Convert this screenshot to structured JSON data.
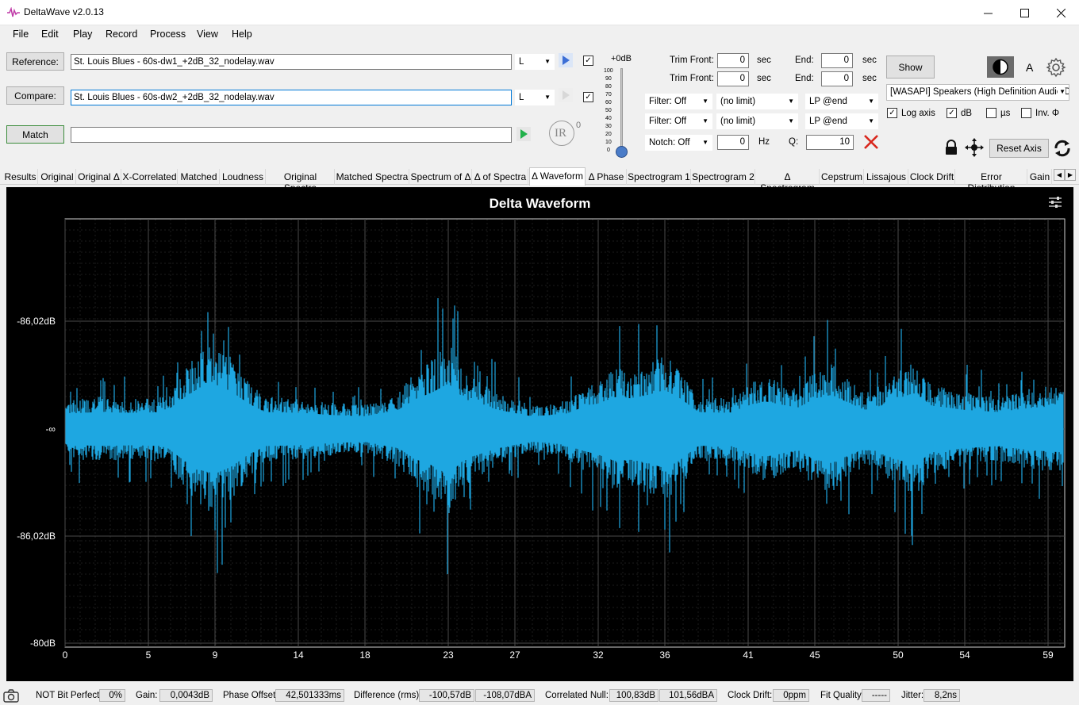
{
  "window": {
    "title": "DeltaWave v2.0.13"
  },
  "menu": [
    "File",
    "Edit",
    "Play",
    "Record",
    "Process",
    "View",
    "Help"
  ],
  "files": {
    "reference_label": "Reference:",
    "reference_file": "St. Louis Blues - 60s-dw1_+2dB_32_nodelay.wav",
    "reference_channel": "L",
    "compare_label": "Compare:",
    "compare_file": "St. Louis Blues - 60s-dw2_+2dB_32_nodelay.wav",
    "compare_channel": "L",
    "match_label": "Match",
    "ir_label": "IR",
    "ir_exponent": "0"
  },
  "volume": {
    "top_label": "+0dB",
    "scale": [
      "100",
      "90",
      "80",
      "70",
      "60",
      "50",
      "40",
      "30",
      "20",
      "10",
      "0"
    ]
  },
  "trim": {
    "front_label": "Trim Front:",
    "front1": "0",
    "front2": "0",
    "unit": "sec",
    "end_label": "End:",
    "end1": "0",
    "end2": "0"
  },
  "filters": {
    "filter1": "Filter: Off",
    "limit1": "(no limit)",
    "lp1": "LP @end",
    "filter2": "Filter: Off",
    "limit2": "(no limit)",
    "lp2": "LP @end",
    "notch": "Notch: Off",
    "notch_value": "0",
    "hz_label": "Hz",
    "q_label": "Q:",
    "q_value": "10"
  },
  "output": {
    "show_label": "Show",
    "device": "[WASAPI] Speakers (High Definition Audio D",
    "theme_letter": "A"
  },
  "options": {
    "log_axis": "Log axis",
    "db": "dB",
    "us": "µs",
    "inv": "Inv. Φ",
    "reset_axis": "Reset Axis"
  },
  "tabs": [
    "Results",
    "Original",
    "Original Δ",
    "X-Correlated",
    "Matched",
    "Loudness",
    "Original Spectra",
    "Matched Spectra",
    "Spectrum of Δ",
    "Δ of Spectra",
    "Δ Waveform",
    "Δ Phase",
    "Spectrogram 1",
    "Spectrogram 2",
    "Δ Spectrogram",
    "Cepstrum",
    "Lissajous",
    "Clock Drift",
    "Error Distribution",
    "Gain"
  ],
  "active_tab": "Δ Waveform",
  "chart_data": {
    "type": "area",
    "title": "Delta Waveform",
    "xlabel": "",
    "ylabel": "",
    "x_ticks": [
      "0",
      "5",
      "9",
      "14",
      "18",
      "23",
      "27",
      "32",
      "36",
      "41",
      "45",
      "50",
      "54",
      "59"
    ],
    "y_tick_labels": [
      "-86,02dB",
      "-∞",
      "-86,02dB",
      "-80dB"
    ],
    "xlim": [
      0,
      60
    ],
    "grid": true,
    "series": [
      {
        "color": "#1ea7e1",
        "x": [
          0,
          2,
          4,
          6,
          7,
          8,
          9,
          10,
          11,
          12,
          14,
          16,
          18,
          20,
          21,
          22,
          23,
          24,
          26,
          28,
          30,
          31,
          32,
          33,
          34,
          35,
          36,
          37,
          38,
          40,
          41,
          42,
          44,
          45,
          46,
          48,
          49,
          50,
          51,
          52,
          54,
          56,
          58,
          60
        ],
        "envelope": [
          0.36,
          0.4,
          0.38,
          0.4,
          0.7,
          0.95,
          1.05,
          0.88,
          0.6,
          0.4,
          0.38,
          0.33,
          0.3,
          0.45,
          0.7,
          0.85,
          1.07,
          0.7,
          0.45,
          0.3,
          0.35,
          0.5,
          0.6,
          0.75,
          0.72,
          0.8,
          0.92,
          0.7,
          0.4,
          0.38,
          0.55,
          0.65,
          0.5,
          0.72,
          0.8,
          0.45,
          0.55,
          0.72,
          0.85,
          0.55,
          0.45,
          0.4,
          0.5,
          0.55
        ]
      }
    ]
  },
  "status": {
    "bit_perfect_label": "NOT Bit Perfect",
    "bit_perfect_value": "0%",
    "gain_label": "Gain:",
    "gain_value": "0,0043dB",
    "phase_label": "Phase Offset:",
    "phase_value": "42,501333ms",
    "diff_label": "Difference (rms):",
    "diff_db": "-100,57dB",
    "diff_dba": "-108,07dBA",
    "null_label": "Correlated Null:",
    "null_db": "100,83dB",
    "null_dba": "101,56dBA",
    "drift_label": "Clock Drift:",
    "drift_value": "0ppm",
    "fit_label": "Fit Quality:",
    "fit_value": "-----",
    "jitter_label": "Jitter:",
    "jitter_value": "8,2ns"
  }
}
